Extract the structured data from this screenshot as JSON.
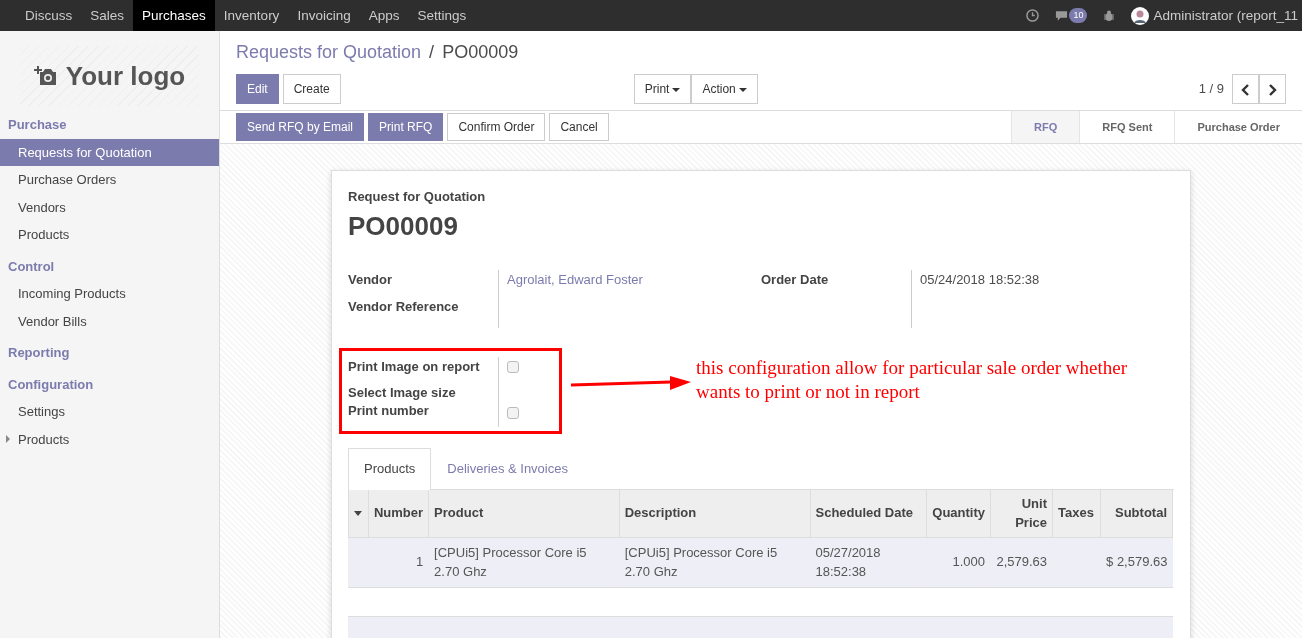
{
  "top_menu": [
    {
      "label": "Discuss",
      "selected": false
    },
    {
      "label": "Sales",
      "selected": false
    },
    {
      "label": "Purchases",
      "selected": true
    },
    {
      "label": "Inventory",
      "selected": false
    },
    {
      "label": "Invoicing",
      "selected": false
    },
    {
      "label": "Apps",
      "selected": false
    },
    {
      "label": "Settings",
      "selected": false
    }
  ],
  "systray": {
    "message_count": "10",
    "user": "Administrator (report_11"
  },
  "logo": {
    "text": "Your logo"
  },
  "sidebar": [
    {
      "title": "Purchase",
      "items": [
        {
          "label": "Requests for Quotation",
          "selected": true,
          "kind": "leaf"
        },
        {
          "label": "Purchase Orders",
          "selected": false,
          "kind": "leaf"
        },
        {
          "label": "Vendors",
          "selected": false,
          "kind": "leaf"
        },
        {
          "label": "Products",
          "selected": false,
          "kind": "leaf"
        }
      ]
    },
    {
      "title": "Control",
      "items": [
        {
          "label": "Incoming Products",
          "selected": false,
          "kind": "leaf"
        },
        {
          "label": "Vendor Bills",
          "selected": false,
          "kind": "leaf"
        }
      ]
    },
    {
      "title": "Reporting"
    },
    {
      "title": "Configuration",
      "items": [
        {
          "label": "Settings",
          "selected": false,
          "kind": "leaf"
        },
        {
          "label": "Products",
          "selected": false,
          "kind": "group"
        }
      ]
    }
  ],
  "breadcrumb": {
    "parent": "Requests for Quotation",
    "separator": "/",
    "current": "PO00009"
  },
  "main_buttons": [
    {
      "label": "Edit",
      "kind": "primary"
    },
    {
      "label": "Create",
      "kind": "secondary"
    }
  ],
  "dropdowns": [
    "Print",
    "Action"
  ],
  "pager": "1 / 9",
  "header_buttons": [
    {
      "label": "Send RFQ by Email",
      "kind": "primary"
    },
    {
      "label": "Print RFQ",
      "kind": "primary"
    },
    {
      "label": "Confirm Order",
      "kind": "secondary"
    },
    {
      "label": "Cancel",
      "kind": "secondary"
    }
  ],
  "stages": [
    {
      "label": "RFQ",
      "selected": true
    },
    {
      "label": "RFQ Sent",
      "selected": false
    },
    {
      "label": "Purchase Order",
      "selected": false
    }
  ],
  "form": {
    "subtitle": "Request for Quotation",
    "name": "PO00009",
    "left_fields": [
      {
        "label": "Vendor",
        "value": "Agrolait, Edward Foster",
        "kind": "link"
      },
      {
        "label": "Vendor Reference"
      }
    ],
    "right_fields": [
      {
        "label": "Order Date",
        "value": "05/24/2018 18:52:38",
        "kind": "text"
      }
    ],
    "options": [
      {
        "label": "Print Image on report",
        "kind": "checkbox",
        "checked": false
      },
      {
        "label": "Select Image size",
        "kind": "text"
      },
      {
        "label": "Print number",
        "kind": "checkbox",
        "checked": false
      }
    ]
  },
  "annotation": "this configuration allow for particular sale order whether wants to print or not in report",
  "tabs": [
    {
      "label": "Products",
      "selected": true
    },
    {
      "label": "Deliveries & Invoices",
      "selected": false
    }
  ],
  "table": {
    "columns": [
      "Number",
      "Product",
      "Description",
      "Scheduled Date",
      "Quantity",
      "Unit Price",
      "Taxes",
      "Subtotal"
    ],
    "rows": [
      [
        "1",
        "[CPUi5] Processor Core i5 2.70 Ghz",
        "[CPUi5] Processor Core i5 2.70 Ghz",
        "05/27/2018 18:52:38",
        "1.000",
        "2,579.63",
        "",
        "$ 2,579.63"
      ]
    ]
  }
}
